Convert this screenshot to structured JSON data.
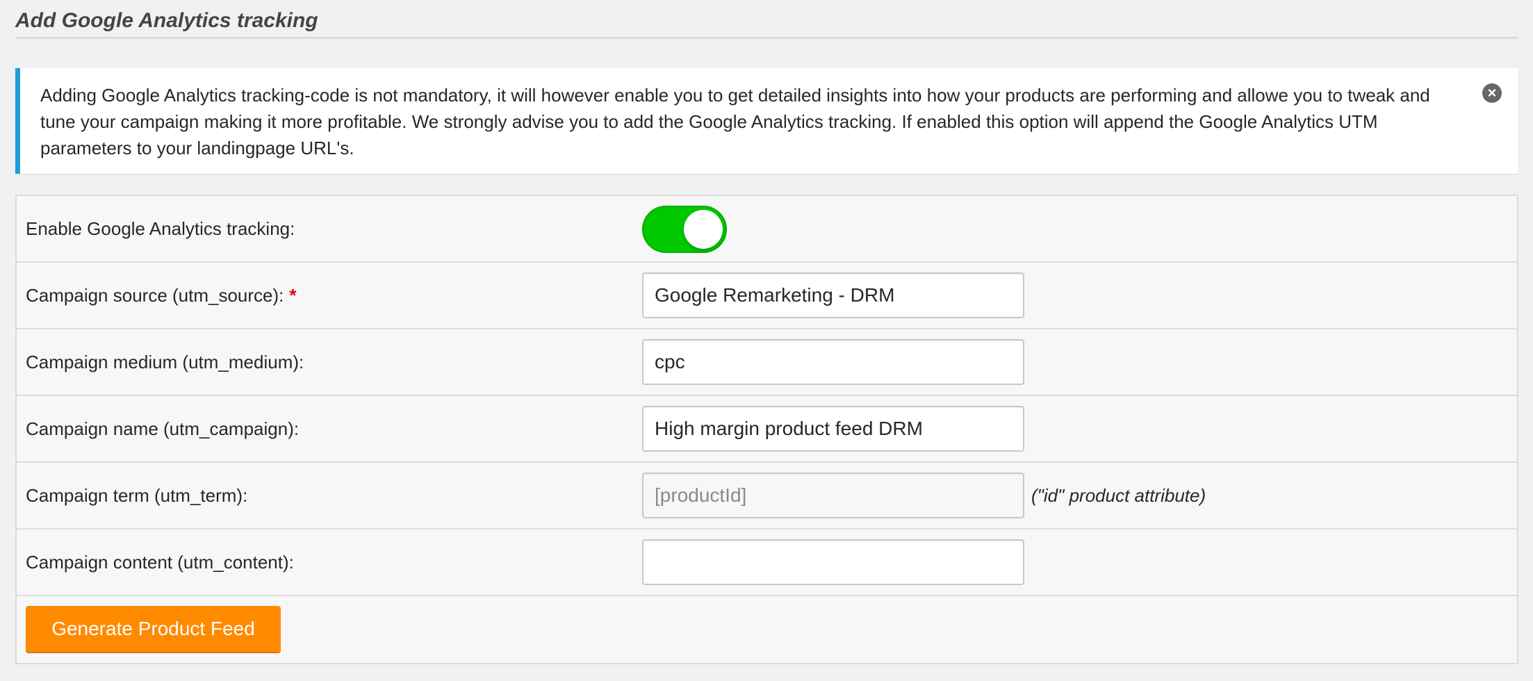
{
  "heading": {
    "title": "Add Google Analytics tracking"
  },
  "notice": {
    "text": "Adding Google Analytics tracking-code is not mandatory, it will however enable you to get detailed insights into how your products are performing and allowe you to tweak and tune your campaign making it more profitable. We strongly advise you to add the Google Analytics tracking. If enabled this option will append the Google Analytics UTM parameters to your landingpage URL's.",
    "dismiss_icon": "close-circle-icon",
    "accent_color": "#1aa0d2"
  },
  "form": {
    "enable_tracking": {
      "label": "Enable Google Analytics tracking:",
      "enabled": true,
      "on_color": "#00c800"
    },
    "utm_source": {
      "label": "Campaign source (utm_source):",
      "required_mark": "*",
      "value": "Google Remarketing - DRM"
    },
    "utm_medium": {
      "label": "Campaign medium (utm_medium):",
      "value": "cpc"
    },
    "utm_campaign": {
      "label": "Campaign name (utm_campaign):",
      "value": "High margin product feed DRM"
    },
    "utm_term": {
      "label": "Campaign term (utm_term):",
      "value": "[productId]",
      "note": "(\"id\" product attribute)"
    },
    "utm_content": {
      "label": "Campaign content (utm_content):",
      "value": ""
    }
  },
  "actions": {
    "generate_label": "Generate Product Feed",
    "generate_color": "#ff8a00"
  }
}
